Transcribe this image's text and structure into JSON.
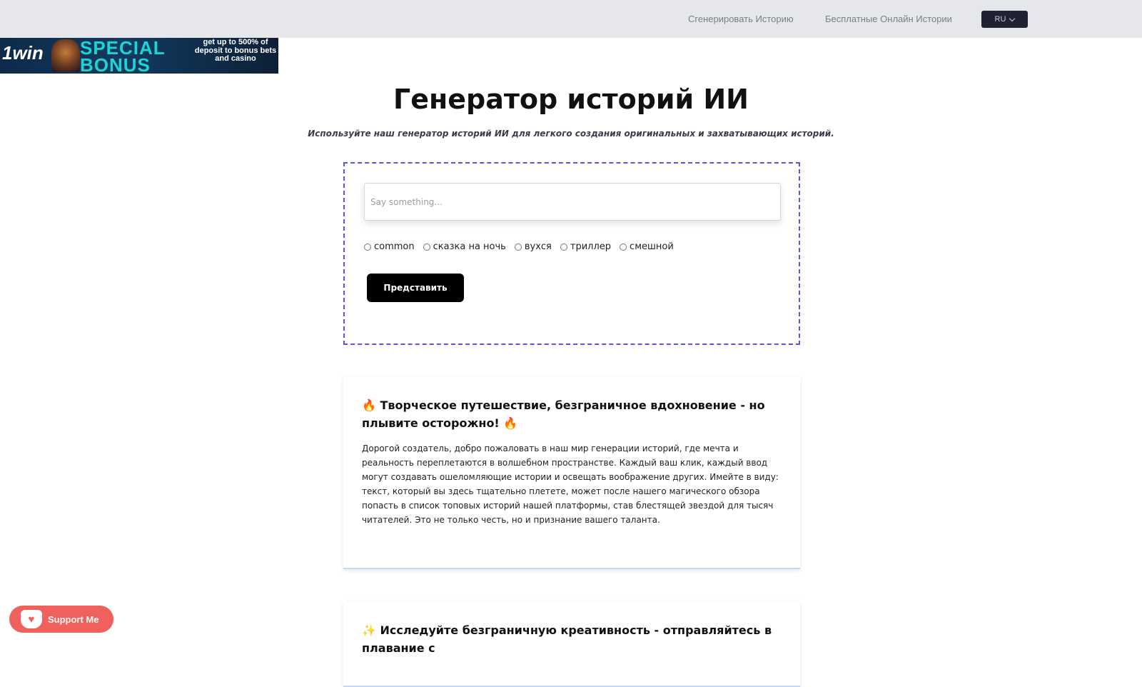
{
  "nav": {
    "link_generate": "Сгенерировать Историю",
    "link_free_stories": "Бесплатные Онлайн Истории",
    "language": "RU"
  },
  "banner": {
    "brand": "1win",
    "headline_1": "SPECIAL",
    "headline_2": "BONUS",
    "small_text": "get up to 500% of deposit to bonus bets and casino"
  },
  "main": {
    "title": "Генератор историй ИИ",
    "subtitle": "Используйте наш генератор историй ИИ для легкого создания оригинальных и захватывающих историй."
  },
  "form": {
    "input_placeholder": "Say something...",
    "input_value": "",
    "genres": [
      "common",
      "сказка на ночь",
      "вухся",
      "триллер",
      "смешной"
    ],
    "submit_label": "Представить"
  },
  "cards": [
    {
      "emoji_left": "🔥",
      "title": "Творческое путешествие, безграничное вдохновение - но плывите осторожно!",
      "emoji_right": "🔥",
      "body": "Дорогой создатель, добро пожаловать в наш мир генерации историй, где мечта и реальность переплетаются в волшебном пространстве. Каждый ваш клик, каждый ввод могут создавать ошеломляющие истории и освещать воображение других. Имейте в виду: текст, который вы здесь тщательно плетете, может после нашего магического обзора попасть в список топовых историй нашей платформы, став блестящей звездой для тысяч читателей. Это не только честь, но и признание вашего таланта."
    },
    {
      "emoji_left": "✨",
      "title": "Исследуйте безграничную креативность - отправляйтесь в плавание с"
    }
  ],
  "support": {
    "label": "Support Me",
    "icon": "ko-fi-cup-icon"
  },
  "colors": {
    "topbar_bg": "#e6e7eb",
    "form_border": "#5a55e8",
    "submit_bg": "#000000",
    "support_bg": "#f0605c",
    "lang_bg": "#1f2230"
  }
}
